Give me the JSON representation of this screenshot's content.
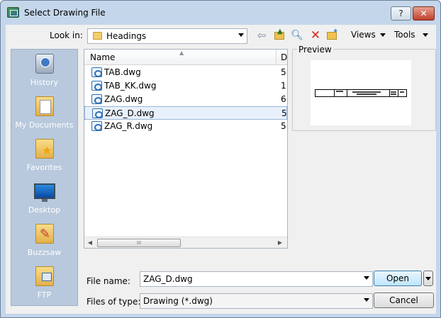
{
  "window": {
    "title": "Select Drawing File",
    "help_label": "?",
    "close_label": "✕"
  },
  "lookin": {
    "label": "Look in:",
    "value": "Headings"
  },
  "toolbar": {
    "views_label": "Views",
    "tools_label": "Tools"
  },
  "places": [
    {
      "label": "History",
      "icon": "history-icon"
    },
    {
      "label": "My Documents",
      "icon": "my-documents-icon"
    },
    {
      "label": "Favorites",
      "icon": "favorites-icon"
    },
    {
      "label": "Desktop",
      "icon": "desktop-icon"
    },
    {
      "label": "Buzzsaw",
      "icon": "buzzsaw-icon"
    },
    {
      "label": "FTP",
      "icon": "ftp-icon"
    }
  ],
  "filelist": {
    "columns": [
      "Name",
      "D"
    ],
    "rows": [
      {
        "name": "TAB.dwg",
        "size": "5",
        "selected": false
      },
      {
        "name": "TAB_KK.dwg",
        "size": "1",
        "selected": false
      },
      {
        "name": "ZAG.dwg",
        "size": "6",
        "selected": false
      },
      {
        "name": "ZAG_D.dwg",
        "size": "5",
        "selected": true
      },
      {
        "name": "ZAG_R.dwg",
        "size": "5",
        "selected": false
      }
    ],
    "scroll_thumb": "III"
  },
  "preview": {
    "label": "Preview"
  },
  "filename": {
    "label": "File name:",
    "value": "ZAG_D.dwg"
  },
  "filetype": {
    "label": "Files of type:",
    "value": "Drawing (*.dwg)"
  },
  "buttons": {
    "open": "Open",
    "cancel": "Cancel"
  }
}
